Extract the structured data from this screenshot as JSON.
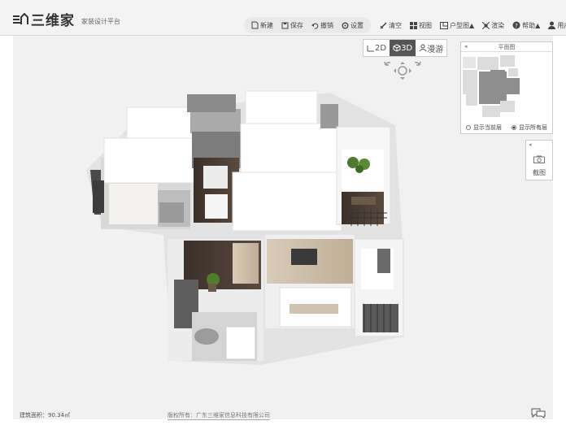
{
  "app": {
    "logo_text": "三维家",
    "subtitle": "家装设计平台"
  },
  "toolbar": {
    "items": [
      "新建",
      "保存",
      "撤销",
      "设置"
    ],
    "right_items": [
      "清空",
      "视图",
      "户型图▲",
      "渲染",
      "帮助▲",
      "用户名"
    ]
  },
  "view": {
    "mode_2d": "2D",
    "mode_3d": "3D",
    "walk": "漫游",
    "active": "3D"
  },
  "minimap": {
    "title": "平面图",
    "option_a": "显示当前层",
    "option_b": "显示所有层",
    "selected": "option_b"
  },
  "side_panel": {
    "label": "截图"
  },
  "status": {
    "area": "建筑面积：90.34㎡",
    "copyright": "版权所有：广东三维家信息科技有限公司"
  },
  "colors": {
    "topbar_bg": "#f3f3f3",
    "canvas_bg": "#f1f1f1",
    "active_view_bg": "#555555"
  },
  "icons": [
    "logo-house-icon",
    "new-file-icon",
    "save-icon",
    "undo-icon",
    "settings-icon",
    "clear-icon",
    "grid-view-icon",
    "floorplan-icon",
    "render-icon",
    "help-icon",
    "user-icon",
    "2d-icon",
    "3d-cube-icon",
    "walk-person-icon",
    "rotate-left-icon",
    "rotate-right-icon",
    "pan-compass-icon",
    "camera-icon",
    "chat-icon"
  ]
}
